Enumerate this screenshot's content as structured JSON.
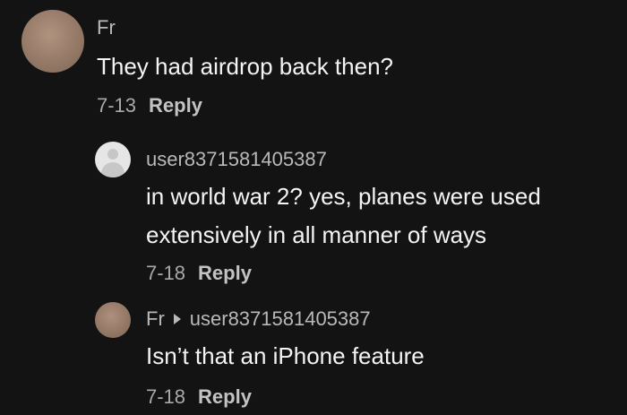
{
  "comments": [
    {
      "username": "Fr",
      "text_lines": [
        "They had airdrop back then?"
      ],
      "date": "7-13",
      "reply_label": "Reply"
    },
    {
      "username": "user8371581405387",
      "text_lines": [
        "in world war 2? yes, planes were used",
        "extensively in all manner of ways"
      ],
      "date": "7-18",
      "reply_label": "Reply"
    },
    {
      "username": "Fr",
      "reply_to": "user8371581405387",
      "text_lines": [
        "Isn’t that an iPhone feature"
      ],
      "date": "7-18",
      "reply_label": "Reply"
    }
  ],
  "icons": {
    "reply_arrow": "caret-right-icon",
    "default_avatar": "default-user-icon"
  },
  "colors": {
    "background": "#131313",
    "username": "#b9b9b9",
    "text": "#f4f4f4",
    "meta": "#a9a9a9"
  }
}
